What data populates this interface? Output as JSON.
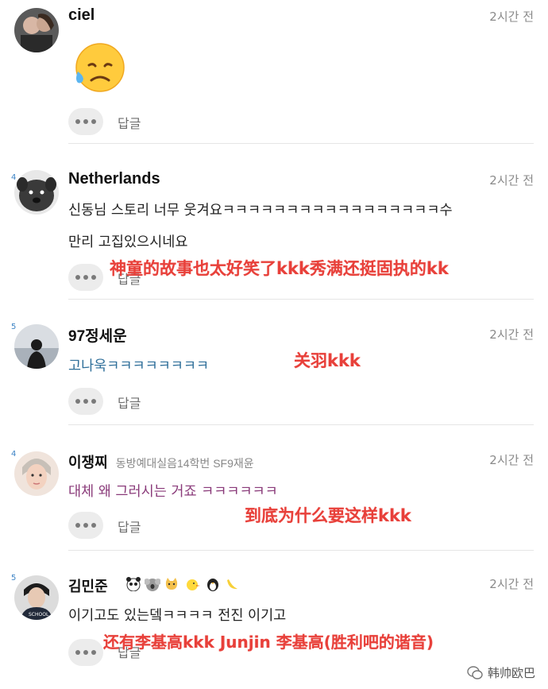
{
  "comments": [
    {
      "name": "ciel",
      "time": "2시간 전",
      "reply": "답글"
    },
    {
      "badge": "4",
      "name": "Netherlands",
      "time": "2시간 전",
      "line1": "신동님 스토리 너무 웃겨요ㅋㅋㅋㅋㅋㅋㅋㅋㅋㅋㅋㅋㅋㅋㅋㅋㅋ수",
      "line2": "만리 고집있으시네요",
      "reply": "답글"
    },
    {
      "badge": "5",
      "name": "97정세운",
      "time": "2시간 전",
      "text": "고나욱ㅋㅋㅋㅋㅋㅋㅋㅋ",
      "reply": "답글"
    },
    {
      "badge": "4",
      "name": "이쟁찌",
      "subtitle": "동방예대실음14학번 SF9재윤",
      "time": "2시간 전",
      "text": "대체 왜 그러시는 거죠 ㅋㅋㅋㅋㅋㅋ",
      "reply": "답글"
    },
    {
      "badge": "5",
      "name": "김민준",
      "time": "2시간 전",
      "text": "이기고도 있는뎈ㅋㅋㅋㅋ 전진 이기고",
      "reply": "답글"
    }
  ],
  "overlays": {
    "o1": "神童的故事也太好笑了kkk秀满还挺固执的kk",
    "o2": "关羽kkk",
    "o3": "到底为什么要这样kkk",
    "o4": "还有李基高kkk Junjin 李基高(胜利吧的谐音)"
  },
  "watermark": "韩帅欧巴",
  "colors": {
    "overlay_red": "#e8403a",
    "comment3_text": "#2f6f9a",
    "comment4_text": "#8a3b7a"
  }
}
